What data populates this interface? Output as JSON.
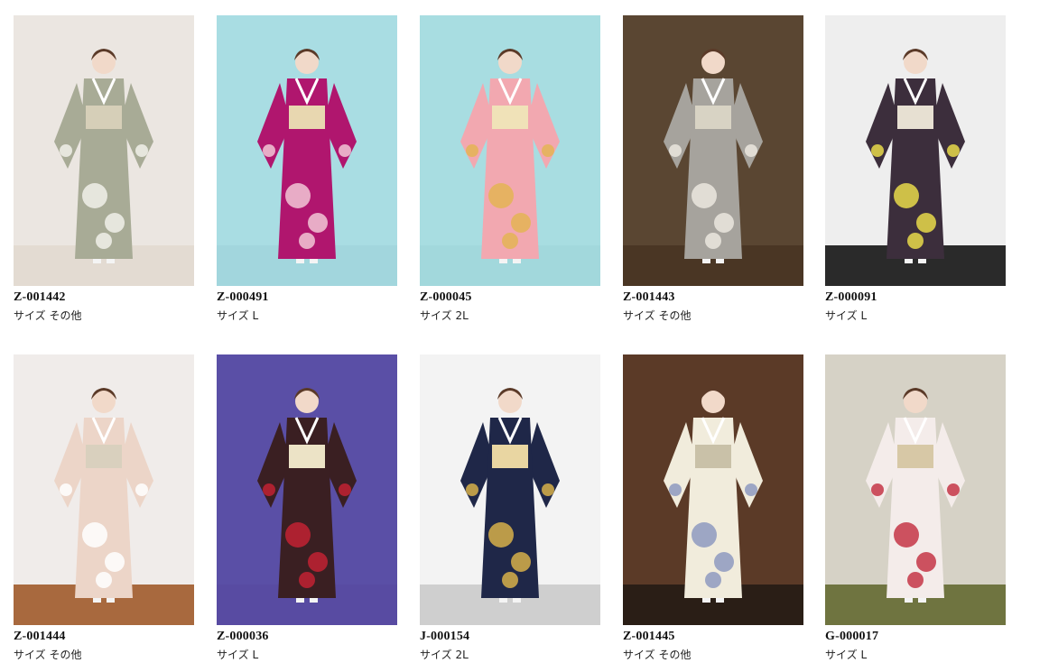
{
  "items": [
    {
      "code": "Z-001442",
      "size": "サイズ その他",
      "bg": "#ebe6e1",
      "floor": "#e3dbd2",
      "kimono": "#a8ab96",
      "pattern": "#f1f0ea",
      "obi": "#d6cfb8",
      "icon": "furisode-photo"
    },
    {
      "code": "Z-000491",
      "size": "サイズ L",
      "bg": "#a9dde3",
      "floor": "#a2d6dd",
      "kimono": "#b0166e",
      "pattern": "#f2c7d6",
      "obi": "#e8d7b0",
      "icon": "furisode-photo"
    },
    {
      "code": "Z-000045",
      "size": "サイズ 2L",
      "bg": "#a8dde1",
      "floor": "#a2d8dc",
      "kimono": "#f2a8b0",
      "pattern": "#e4b455",
      "obi": "#f0e2b8",
      "icon": "furisode-photo"
    },
    {
      "code": "Z-001443",
      "size": "サイズ その他",
      "bg": "#5a4632",
      "floor": "#4a3624",
      "kimono": "#a6a39d",
      "pattern": "#ebe8df",
      "obi": "#d8d3c4",
      "icon": "furisode-photo"
    },
    {
      "code": "Z-000091",
      "size": "サイズ L",
      "bg": "#eeeeee",
      "floor": "#2a2a2a",
      "kimono": "#3c2e3c",
      "pattern": "#e8d94a",
      "obi": "#e7e0d2",
      "icon": "furisode-photo"
    },
    {
      "code": "Z-001444",
      "size": "サイズ その他",
      "bg": "#f0ecea",
      "floor": "#a8693e",
      "kimono": "#ecd5c8",
      "pattern": "#ffffff",
      "obi": "#d9d0be",
      "icon": "furisode-photo"
    },
    {
      "code": "Z-000036",
      "size": "サイズ L",
      "bg": "#5a4fa6",
      "floor": "#584ba2",
      "kimono": "#3a1f22",
      "pattern": "#c22232",
      "obi": "#ece3c6",
      "icon": "furisode-photo"
    },
    {
      "code": "J-000154",
      "size": "サイズ 2L",
      "bg": "#f3f3f3",
      "floor": "#cfcfcf",
      "kimono": "#1f2748",
      "pattern": "#d7b04a",
      "obi": "#e9d6a2",
      "icon": "furisode-photo"
    },
    {
      "code": "Z-001445",
      "size": "サイズ その他",
      "bg": "#5b3a27",
      "floor": "#2a1e16",
      "kimono": "#f1ecdc",
      "pattern": "#8e9ac0",
      "obi": "#c9c1a8",
      "icon": "furisode-photo"
    },
    {
      "code": "G-000017",
      "size": "サイズ L",
      "bg": "#d6d2c6",
      "floor": "#6f7440",
      "kimono": "#f4ecea",
      "pattern": "#c43646",
      "obi": "#d7c8a6",
      "icon": "furisode-photo"
    }
  ]
}
